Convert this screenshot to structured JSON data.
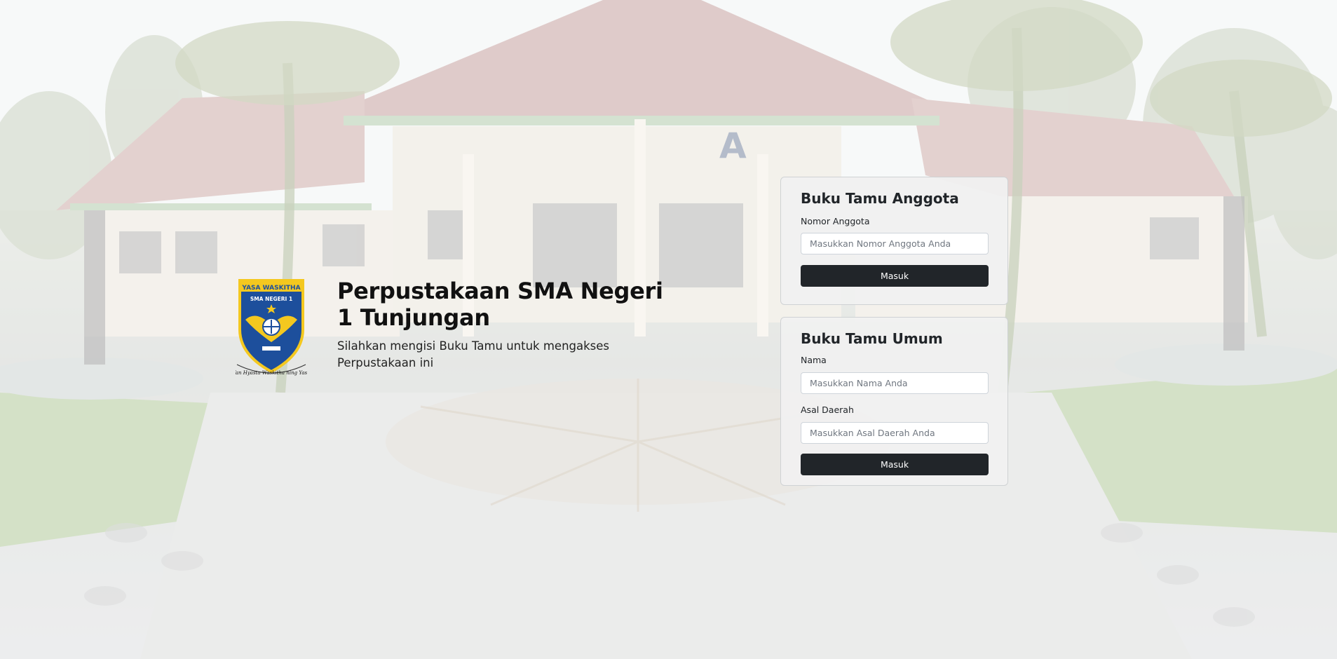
{
  "hero": {
    "title": "Perpustakaan SMA Negeri 1 Tunjungan",
    "subtitle": "Silahkan mengisi Buku Tamu untuk mengakses Perpustakaan ini",
    "logo": {
      "top_text": "YASA WASKITHA",
      "school_text": "SMA NEGERI 1",
      "motto": "Tan Hyasta Waskitha ning Yasa"
    }
  },
  "member_form": {
    "title": "Buku Tamu Anggota",
    "member_number_label": "Nomor Anggota",
    "member_number_placeholder": "Masukkan Nomor Anggota Anda",
    "member_number_value": "",
    "submit_label": "Masuk"
  },
  "general_form": {
    "title": "Buku Tamu Umum",
    "name_label": "Nama",
    "name_placeholder": "Masukkan Nama Anda",
    "name_value": "",
    "origin_label": "Asal Daerah",
    "origin_placeholder": "Masukkan Asal Daerah Anda",
    "origin_value": "",
    "submit_label": "Masuk"
  },
  "colors": {
    "button_bg": "#212529",
    "card_bg": "#f0f0f0",
    "logo_blue": "#1d4f9c",
    "logo_yellow": "#f4c81f"
  },
  "icons": {
    "logo": "school-crest-icon"
  }
}
